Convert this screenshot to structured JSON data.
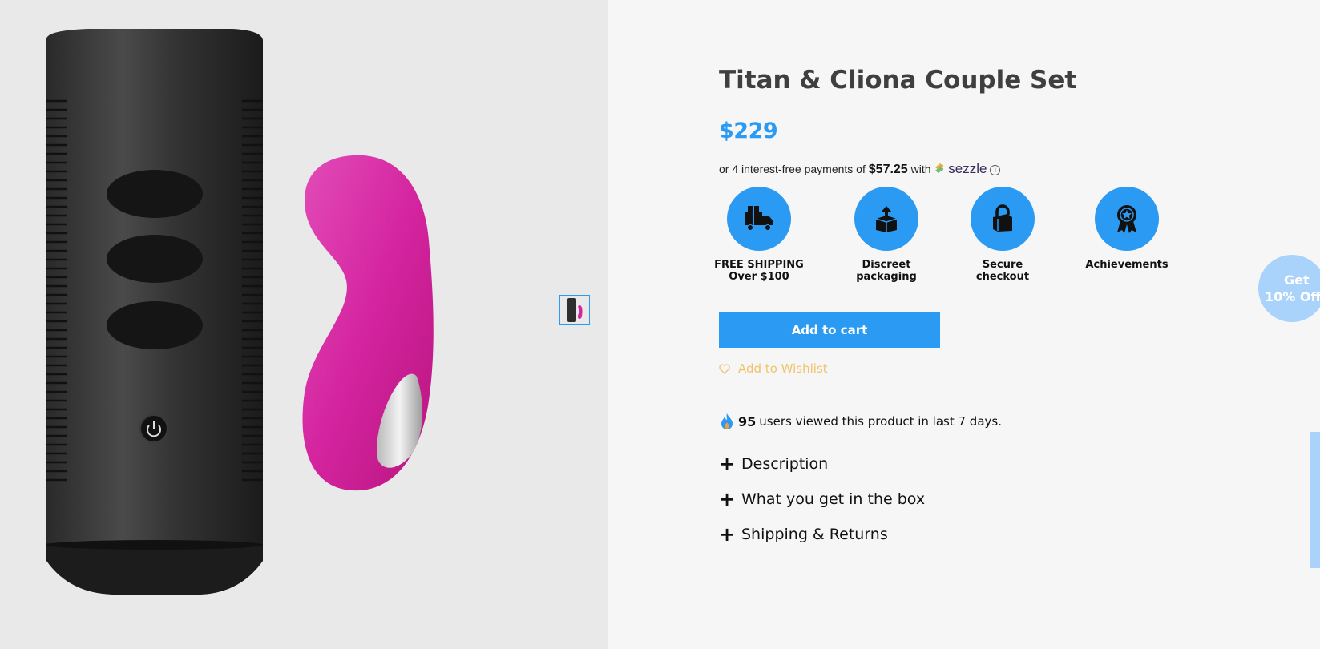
{
  "product": {
    "title": "Titan & Cliona Couple Set",
    "price": "$229",
    "image_alt": "Titan & Cliona Couple Set"
  },
  "sezzle": {
    "prefix": "or 4 interest-free payments of",
    "amount": "$57.25",
    "with": "with",
    "brand": "sezzle",
    "info_icon": "ⓘ"
  },
  "features": [
    {
      "icon": "truck-gift-icon",
      "line1": "FREE SHIPPING",
      "line2": "Over $100"
    },
    {
      "icon": "package-box-icon",
      "line1": "Discreet",
      "line2": "packaging"
    },
    {
      "icon": "padlock-icon",
      "line1": "Secure",
      "line2": "checkout"
    },
    {
      "icon": "award-badge-icon",
      "line1": "Achievements",
      "line2": ""
    }
  ],
  "actions": {
    "add_to_cart": "Add to cart",
    "wishlist": "Add to Wishlist"
  },
  "viewers": {
    "count": "95",
    "text": "users viewed this product in last 7 days."
  },
  "accordion": [
    {
      "label": "Description"
    },
    {
      "label": "What you get in the box"
    },
    {
      "label": "Shipping & Returns"
    }
  ],
  "promo": {
    "line1": "Get",
    "line2": "10% Off"
  },
  "colors": {
    "accent": "#2b9af3",
    "wishlist": "#f0c36a",
    "product_pink": "#d92aa6",
    "promo_bg": "#a9d3fb"
  }
}
